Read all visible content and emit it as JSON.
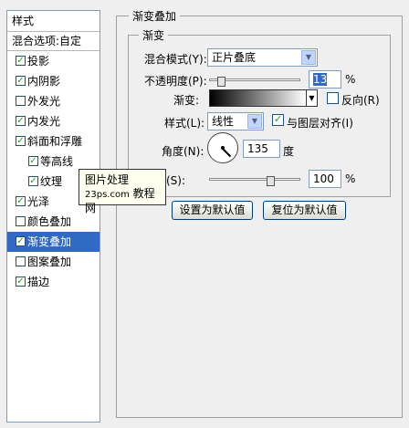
{
  "left_panel": {
    "header": "样式",
    "blend_options": "混合选项:自定",
    "items": [
      {
        "label": "投影",
        "checked": "✓"
      },
      {
        "label": "内阴影",
        "checked": "✓"
      },
      {
        "label": "外发光",
        "checked": ""
      },
      {
        "label": "内发光",
        "checked": "✓"
      },
      {
        "label": "斜面和浮雕",
        "checked": "✓"
      },
      {
        "label": "等高线",
        "checked": "✓"
      },
      {
        "label": "纹理",
        "checked": "✓"
      },
      {
        "label": "光泽",
        "checked": "✓"
      },
      {
        "label": "颜色叠加",
        "checked": ""
      },
      {
        "label": "渐变叠加",
        "checked": "✓"
      },
      {
        "label": "图案叠加",
        "checked": ""
      },
      {
        "label": "描边",
        "checked": "✓"
      }
    ]
  },
  "tooltip": {
    "line1": "图片处理",
    "line2_site": "23ps.com",
    "line2_text": "教程网"
  },
  "panel": {
    "title": "渐变叠加",
    "group_title": "渐变",
    "blend_mode_label": "混合模式(Y):",
    "blend_mode_value": "正片叠底",
    "opacity_label": "不透明度(P):",
    "opacity_value": "13",
    "opacity_unit": "%",
    "opacity_level": 0.13,
    "gradient_label": "渐变:",
    "reverse_label": "反向(R)",
    "reverse_checked": "",
    "style_label": "样式(L):",
    "style_value": "线性",
    "align_label": "与图层对齐(I)",
    "align_checked": "✓",
    "angle_label": "角度(N):",
    "angle_value": "135",
    "angle_unit": "度",
    "scale_label": "缩放(S):",
    "scale_value": "100",
    "scale_unit": "%",
    "scale_level": 0.67,
    "btn_default": "设置为默认值",
    "btn_reset": "复位为默认值"
  },
  "colors": {
    "accent": "#316ac5",
    "check": "#21a121"
  }
}
